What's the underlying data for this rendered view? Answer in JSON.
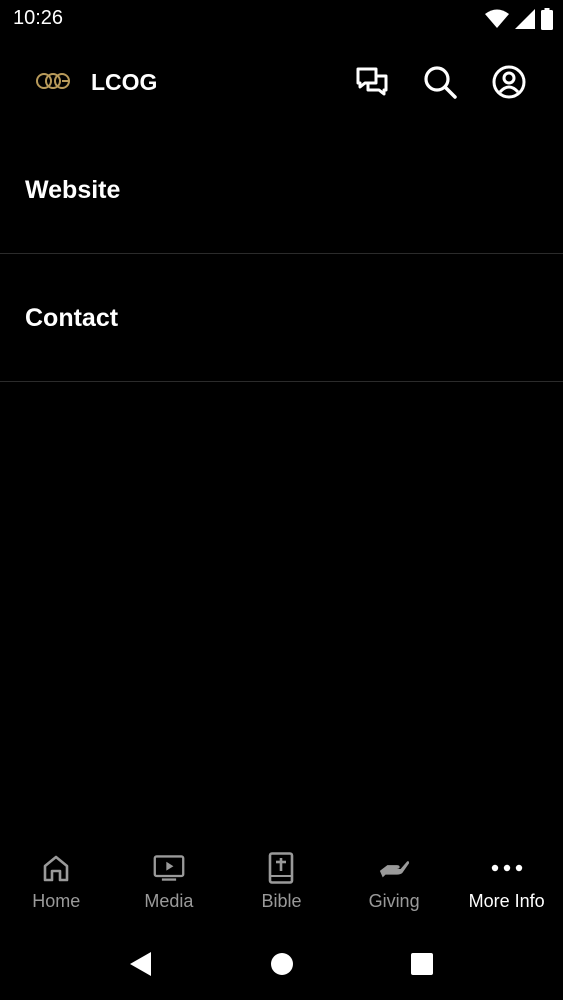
{
  "status_bar": {
    "time": "10:26"
  },
  "app_bar": {
    "title": "LCOG",
    "logo_text": "LCOG"
  },
  "menu": {
    "items": [
      {
        "label": "Website"
      },
      {
        "label": "Contact"
      }
    ]
  },
  "bottom_nav": {
    "items": [
      {
        "label": "Home",
        "icon": "home-icon"
      },
      {
        "label": "Media",
        "icon": "tv-play-icon"
      },
      {
        "label": "Bible",
        "icon": "bible-icon"
      },
      {
        "label": "Giving",
        "icon": "giving-hand-icon"
      },
      {
        "label": "More Info",
        "icon": "more-dots-icon",
        "active": true
      }
    ]
  },
  "colors": {
    "background": "#000000",
    "text": "#ffffff",
    "inactive": "#9a9a9a",
    "divider": "#2b2b2b",
    "logo_gold": "#b89a5a"
  }
}
